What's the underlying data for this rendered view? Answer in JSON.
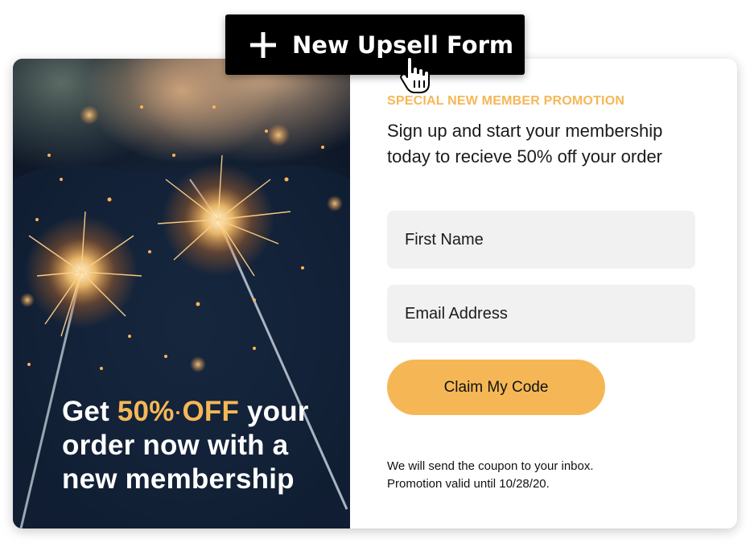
{
  "toolbar": {
    "new_button_label": "New Upsell Form",
    "new_button_icon": "plus-icon",
    "cursor_icon": "hand-pointer-icon"
  },
  "promo_image": {
    "headline_prefix": "Get ",
    "headline_accent": "50% OFF",
    "headline_rest": " your order now with a new membership"
  },
  "form": {
    "eyebrow": "SPECIAL NEW MEMBER PROMOTION",
    "intro": "Sign up and start your membership today to recieve 50% off your order",
    "first_name_placeholder": "First Name",
    "email_placeholder": "Email Address",
    "submit_label": "Claim My Code",
    "footnote_line1": "We will send the coupon to your inbox.",
    "footnote_line2": "Promotion valid until 10/28/20."
  },
  "colors": {
    "accent": "#f5b756",
    "button_bg": "#000000",
    "field_bg": "#f1f1f1",
    "text": "#1b1b1b"
  }
}
